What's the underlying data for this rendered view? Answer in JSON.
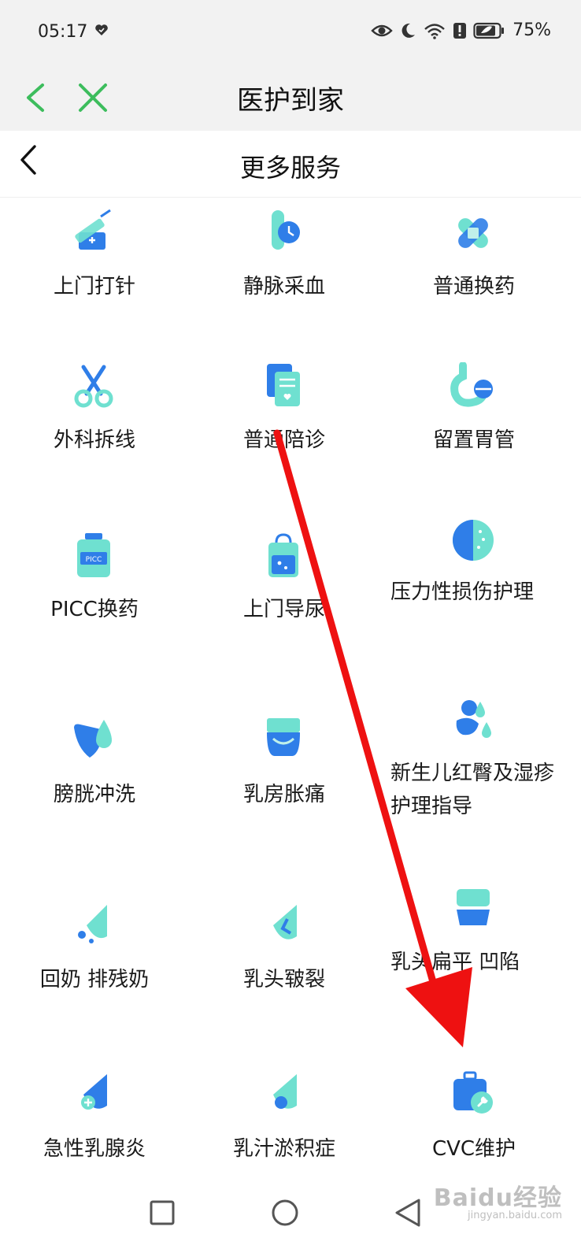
{
  "status_bar": {
    "time": "05:17",
    "battery": "75%"
  },
  "app_bar": {
    "title": "医护到家"
  },
  "page_header": {
    "title": "更多服务"
  },
  "services": [
    {
      "label": "上门打针",
      "icon": "injection-icon"
    },
    {
      "label": "静脉采血",
      "icon": "blood-test-tube-icon"
    },
    {
      "label": "普通换药",
      "icon": "bandage-icon"
    },
    {
      "label": "外科拆线",
      "icon": "scissors-icon"
    },
    {
      "label": "普通陪诊",
      "icon": "medical-record-icon"
    },
    {
      "label": "留置胃管",
      "icon": "stomach-icon"
    },
    {
      "label": "PICC换药",
      "icon": "picc-bottle-icon"
    },
    {
      "label": "上门导尿",
      "icon": "urine-bag-icon"
    },
    {
      "label": "压力性损伤护理",
      "icon": "pressure-injury-icon"
    },
    {
      "label": "膀胱冲洗",
      "icon": "bladder-icon"
    },
    {
      "label": "乳房胀痛",
      "icon": "breast-pain-icon"
    },
    {
      "label": "新生儿红臀及湿疹护理指导",
      "icon": "newborn-icon"
    },
    {
      "label": "回奶 排残奶",
      "icon": "milk-drop-icon"
    },
    {
      "label": "乳头皲裂",
      "icon": "nipple-crack-icon"
    },
    {
      "label": "乳头扁平 凹陷",
      "icon": "flat-nipple-icon"
    },
    {
      "label": "急性乳腺炎",
      "icon": "mastitis-icon"
    },
    {
      "label": "乳汁淤积症",
      "icon": "milk-stasis-icon"
    },
    {
      "label": "CVC维护",
      "icon": "cvc-kit-icon"
    }
  ],
  "watermark": {
    "main": "Baidu经验",
    "sub": "jingyan.baidu.com"
  },
  "colors": {
    "accent_green": "#3dbd5d",
    "annotation_red": "#ee1111",
    "icon_blue": "#2f7ee8",
    "icon_teal": "#5fd3c6"
  }
}
